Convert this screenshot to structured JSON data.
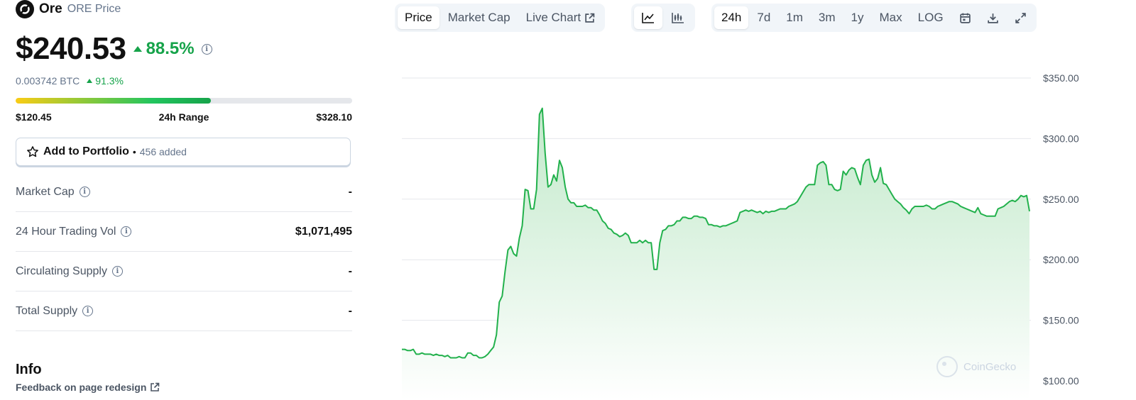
{
  "coin": {
    "name": "Ore",
    "subtitle": "ORE Price"
  },
  "price": {
    "value": "$240.53",
    "change": "88.5%"
  },
  "btc": {
    "value": "0.003742 BTC",
    "change": "91.3%"
  },
  "range": {
    "low": "$120.45",
    "label": "24h Range",
    "high": "$328.10",
    "fill_percent": 58
  },
  "portfolio": {
    "label": "Add to Portfolio",
    "separator": "•",
    "count": "456 added"
  },
  "stats": [
    {
      "label": "Market Cap",
      "value": "-"
    },
    {
      "label": "24 Hour Trading Vol",
      "value": "$1,071,495"
    },
    {
      "label": "Circulating Supply",
      "value": "-"
    },
    {
      "label": "Total Supply",
      "value": "-"
    }
  ],
  "info": {
    "title": "Info",
    "feedback": "Feedback on page redesign"
  },
  "toolbar": {
    "tabs": [
      "Price",
      "Market Cap",
      "Live Chart"
    ],
    "chart_types": [
      "line-chart-icon",
      "candlestick-icon"
    ],
    "ranges": [
      "24h",
      "7d",
      "1m",
      "3m",
      "1y",
      "Max",
      "LOG"
    ],
    "actions": [
      "calendar-icon",
      "download-icon",
      "expand-icon"
    ]
  },
  "watermark": "CoinGecko",
  "colors": {
    "up": "#16a34a",
    "line": "#22b14c",
    "fill_top": "#bfe8c8"
  },
  "chart_data": {
    "type": "area",
    "title": "",
    "xlabel": "",
    "ylabel": "",
    "ylim": [
      95,
      360
    ],
    "y_ticks": [
      "$100.00",
      "$150.00",
      "$200.00",
      "$250.00",
      "$300.00",
      "$350.00"
    ],
    "y_tick_values": [
      100,
      150,
      200,
      250,
      300,
      350
    ],
    "grid": true,
    "series": [
      {
        "values": [
          126,
          126,
          125,
          125,
          126,
          122,
          122,
          123,
          122,
          122,
          122,
          121,
          122,
          121,
          121,
          120,
          121,
          119,
          119,
          119,
          120,
          119,
          119,
          123,
          123,
          121,
          121,
          119,
          119,
          120,
          122,
          125,
          128,
          138,
          165,
          170,
          190,
          208,
          211,
          205,
          203,
          218,
          228,
          258,
          257,
          242,
          242,
          258,
          320,
          325,
          288,
          260,
          262,
          270,
          265,
          282,
          276,
          260,
          250,
          247,
          247,
          244,
          244,
          244,
          245,
          243,
          243,
          241,
          241,
          237,
          232,
          230,
          226,
          225,
          222,
          221,
          219,
          220,
          222,
          220,
          214,
          214,
          214,
          216,
          214,
          216,
          214,
          214,
          192,
          192,
          214,
          224,
          225,
          228,
          228,
          229,
          232,
          232,
          235,
          235,
          234,
          234,
          236,
          236,
          235,
          235,
          234,
          229,
          229,
          228,
          228,
          227,
          228,
          228,
          229,
          230,
          231,
          232,
          239,
          240,
          241,
          240,
          241,
          240,
          239,
          240,
          238,
          240,
          239,
          240,
          240,
          241,
          242,
          242,
          242,
          244,
          245,
          246,
          248,
          252,
          256,
          260,
          262,
          262,
          262,
          278,
          280,
          281,
          278,
          262,
          262,
          258,
          257,
          258,
          273,
          270,
          274,
          276,
          275,
          268,
          262,
          278,
          282,
          283,
          270,
          264,
          267,
          276,
          263,
          262,
          258,
          254,
          250,
          248,
          246,
          243,
          241,
          238,
          242,
          244,
          244,
          244,
          244,
          245,
          244,
          242,
          242,
          244,
          245,
          246,
          247,
          248,
          248,
          247,
          246,
          244,
          243,
          242,
          241,
          240,
          239,
          243,
          238,
          237,
          236,
          236,
          236,
          236,
          242,
          243,
          244,
          246,
          248,
          249,
          248,
          250,
          253,
          252,
          253,
          240
        ]
      }
    ]
  }
}
